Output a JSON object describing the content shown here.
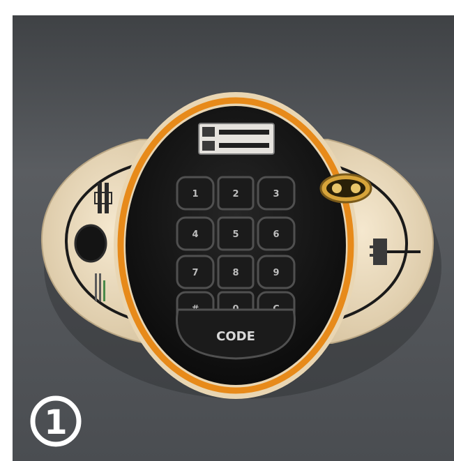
{
  "step_number": "①",
  "keypad": {
    "keys": [
      "1",
      "2",
      "3",
      "4",
      "5",
      "6",
      "7",
      "8",
      "9",
      "#",
      "0",
      "C"
    ],
    "code_key": "CODE"
  },
  "colors": {
    "backdrop": "#4d5054",
    "body_cream": "#ecdcc0",
    "body_black": "#141414",
    "accent_orange": "#e78a1a",
    "key_face": "#1b1b1b",
    "key_outline": "#505050"
  }
}
